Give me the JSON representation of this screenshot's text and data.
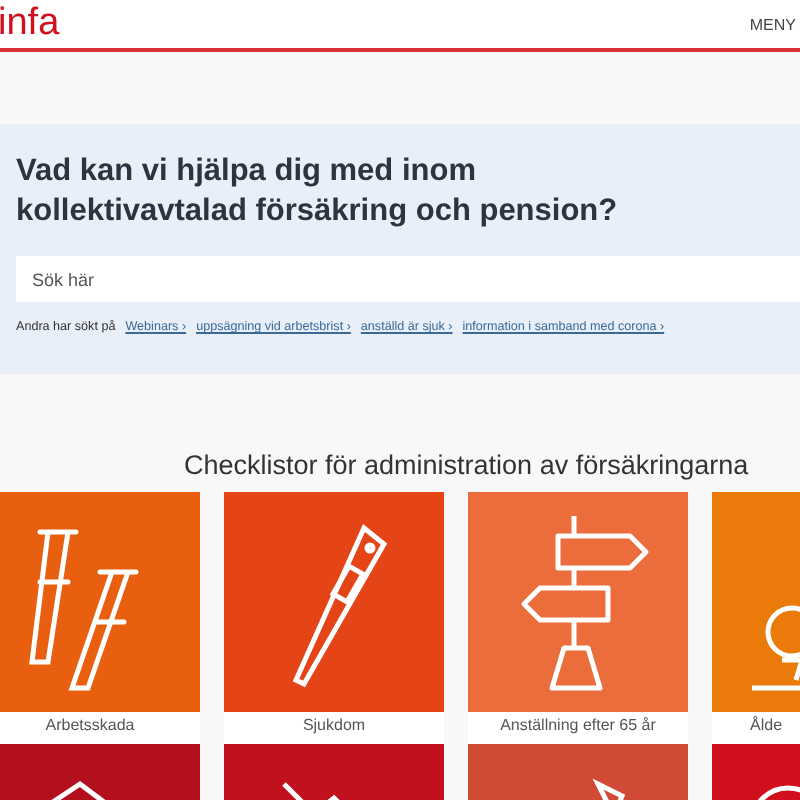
{
  "header": {
    "logo": "infa",
    "menu": "MENY"
  },
  "search_panel": {
    "title": "Vad kan vi hjälpa dig med inom kollektivavtalad försäkring och pension?",
    "placeholder": "Sök här",
    "recent_label": "Andra har sökt på",
    "recent_links": [
      "Webinars ›",
      "uppsägning vid arbetsbrist ›",
      "anställd är sjuk ›",
      "information i samband med corona ›"
    ]
  },
  "checklists": {
    "heading": "Checklistor för administration av försäkringarna",
    "tiles": [
      {
        "label": "Arbetsskada",
        "color": "#e8600f",
        "kind": "crutches"
      },
      {
        "label": "Sjukdom",
        "color": "#e44416",
        "kind": "thermometer"
      },
      {
        "label": "Anställning efter 65 år",
        "color": "#ec6d3c",
        "kind": "signpost"
      },
      {
        "label": "Ålde",
        "color": "#ea7a0a",
        "kind": "golf"
      },
      {
        "color": "#b3101e",
        "kind": "umbrella"
      },
      {
        "color": "#c3101e",
        "kind": "chart"
      },
      {
        "color": "#d04a35",
        "kind": "cone"
      },
      {
        "color": "#d0101e",
        "kind": "ball"
      }
    ]
  }
}
